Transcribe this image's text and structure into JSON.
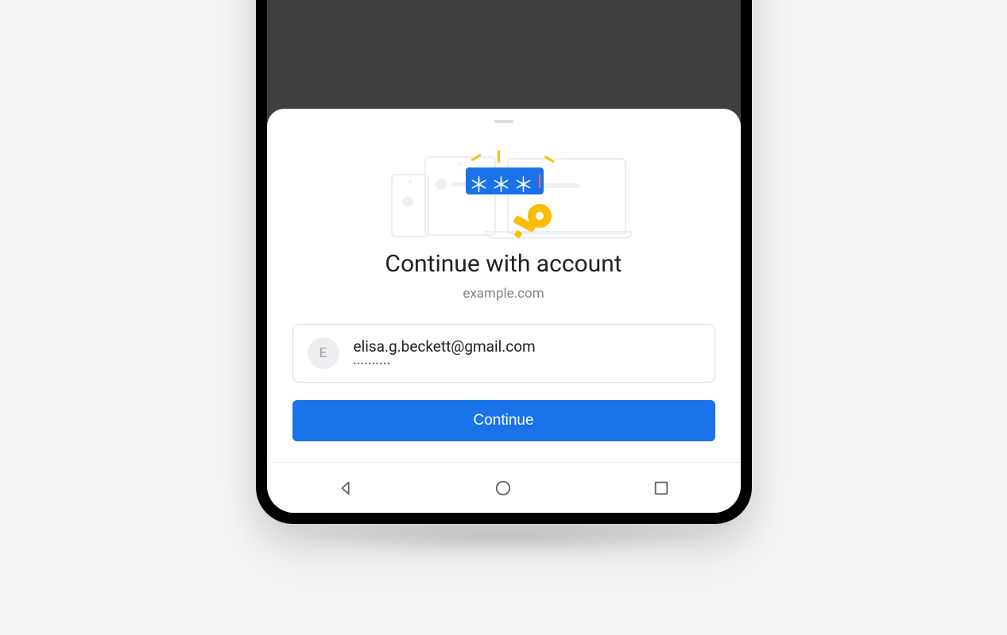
{
  "dialog": {
    "title": "Continue with account",
    "domain": "example.com"
  },
  "account": {
    "initial": "E",
    "email": "elisa.g.beckett@gmail.com",
    "password_mask": "••••••••••"
  },
  "actions": {
    "continue_label": "Continue"
  },
  "hero": {
    "password_glyphs": "＊＊＊"
  }
}
